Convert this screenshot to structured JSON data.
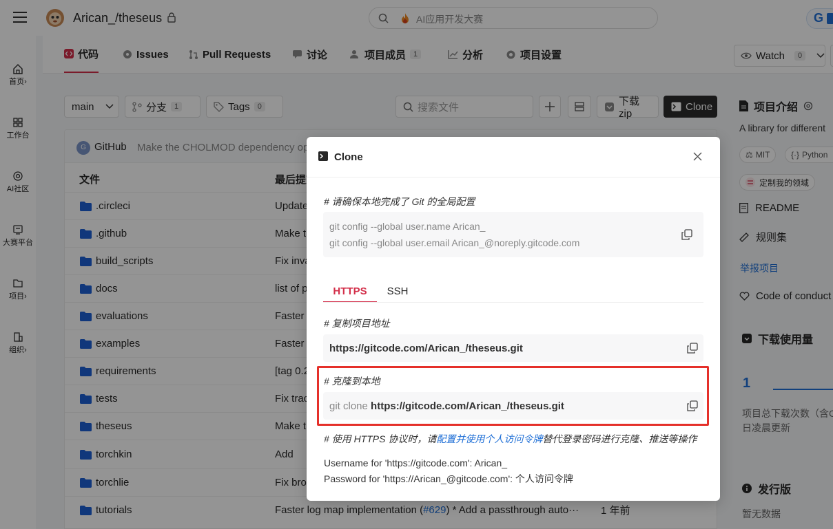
{
  "repo": {
    "owner_repo": "Arican_/theseus"
  },
  "search": {
    "placeholder": "AI应用开发大赛"
  },
  "sidebar": {
    "items": [
      {
        "label": "首页",
        "arrow": "›"
      },
      {
        "label": "工作台",
        "arrow": ""
      },
      {
        "label": "AI社区",
        "arrow": ""
      },
      {
        "label": "大赛平台",
        "arrow": ""
      },
      {
        "label": "项目",
        "arrow": "›"
      },
      {
        "label": "组织",
        "arrow": "›"
      }
    ]
  },
  "tabs": [
    {
      "label": "代码",
      "count": ""
    },
    {
      "label": "Issues",
      "count": ""
    },
    {
      "label": "Pull Requests",
      "count": ""
    },
    {
      "label": "讨论",
      "count": ""
    },
    {
      "label": "项目成员",
      "count": "1"
    },
    {
      "label": "分析",
      "count": ""
    },
    {
      "label": "项目设置",
      "count": ""
    }
  ],
  "watch": {
    "label": "Watch",
    "count": "0"
  },
  "toolbar": {
    "branch": "main",
    "branches_label": "分支",
    "branches_count": "1",
    "tags_label": "Tags",
    "tags_count": "0",
    "file_search_placeholder": "搜索文件",
    "download_label": "下载zip",
    "clone_label": "Clone"
  },
  "commit": {
    "author": "GitHub",
    "avatar_letter": "G",
    "message": "Make the CHOLMOD dependency optio"
  },
  "files": {
    "header_file": "文件",
    "header_commit": "最后提交",
    "rows": [
      {
        "name": ".circleci",
        "msg": "Update",
        "time": ""
      },
      {
        "name": ".github",
        "msg": "Make th",
        "time": ""
      },
      {
        "name": "build_scripts",
        "msg": "Fix inva",
        "time": ""
      },
      {
        "name": "docs",
        "msg": "list of p",
        "time": ""
      },
      {
        "name": "evaluations",
        "msg": "Faster l",
        "time": ""
      },
      {
        "name": "examples",
        "msg": "Faster l",
        "time": ""
      },
      {
        "name": "requirements",
        "msg": "[tag 0.2",
        "time": ""
      },
      {
        "name": "tests",
        "msg": "Fix trac",
        "time": ""
      },
      {
        "name": "theseus",
        "msg": "Make th",
        "time": ""
      },
      {
        "name": "torchkin",
        "msg": "Add",
        "time": ""
      },
      {
        "name": "torchlie",
        "msg": "Fix brol",
        "time": ""
      },
      {
        "name": "tutorials",
        "msg": "Faster log map implementation (",
        "link": "#629",
        "msg2": ") * Add a passthrough auto···",
        "time": "1 年前"
      }
    ]
  },
  "right": {
    "intro_title": "项目介绍",
    "intro_desc": "A library for different",
    "license": "MIT",
    "lang": "Python",
    "customize": "定制我的领域",
    "readme": "README",
    "rules": "规则集",
    "report": "举报项目",
    "conduct": "Code of conduct",
    "downloads_title": "下载使用量",
    "downloads_count": "1",
    "downloads_desc1": "项目总下载次数（含C",
    "downloads_desc2": "日凌晨更新",
    "release_title": "发行版",
    "release_empty": "暂无数据"
  },
  "modal": {
    "title": "Clone",
    "config_comment": "# 请确保本地完成了 Git 的全局配置",
    "config_line1": "git config --global user.name Arican_",
    "config_line2": "git config --global user.email Arican_@noreply.gitcode.com",
    "tab_https": "HTTPS",
    "tab_ssh": "SSH",
    "copy_comment": "# 复制项目地址",
    "url": "https://gitcode.com/Arican_/theseus.git",
    "clone_comment": "# 克隆到本地",
    "clone_cmd": "git clone",
    "clone_url": "https://gitcode.com/Arican_/theseus.git",
    "https_note_prefix": "# 使用 HTTPS 协议时，请",
    "https_note_link": "配置并使用个人访问令牌",
    "https_note_suffix": "替代登录密码进行克隆、推送等操作",
    "username_line": "Username for 'https://gitcode.com': Arican_",
    "password_line": "Password for 'https://Arican_@gitcode.com': 个人访问令牌"
  },
  "colors": {
    "accent": "#d32f4a",
    "highlight_border": "#e5302a",
    "link": "#1f6fd6",
    "clone_btn_bg": "#2b2b2b"
  }
}
